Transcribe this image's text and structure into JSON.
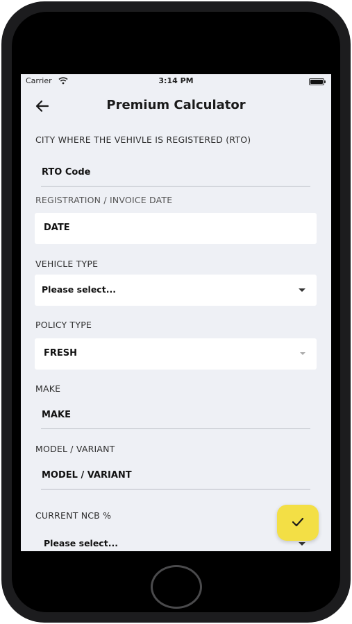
{
  "status_bar": {
    "carrier": "Carrier",
    "time": "3:14 PM"
  },
  "header": {
    "title": "Premium Calculator",
    "back_icon": "arrow-left-icon"
  },
  "form": {
    "rto": {
      "label": "CITY WHERE THE VEHIVLE IS REGISTERED (RTO)",
      "value": "RTO Code"
    },
    "date": {
      "label": "REGISTRATION / INVOICE DATE",
      "value": "DATE"
    },
    "vehicle_type": {
      "label": "VEHICLE TYPE",
      "value": "Please select..."
    },
    "policy_type": {
      "label": "POLICY TYPE",
      "value": "FRESH"
    },
    "make": {
      "label": "MAKE",
      "value": "MAKE"
    },
    "model": {
      "label": "MODEL / VARIANT",
      "value": "MODEL / VARIANT"
    },
    "ncb": {
      "label": "CURRENT NCB %",
      "value": "Please select..."
    }
  },
  "fab": {
    "icon": "checkmark-icon",
    "color": "#f3df45"
  }
}
